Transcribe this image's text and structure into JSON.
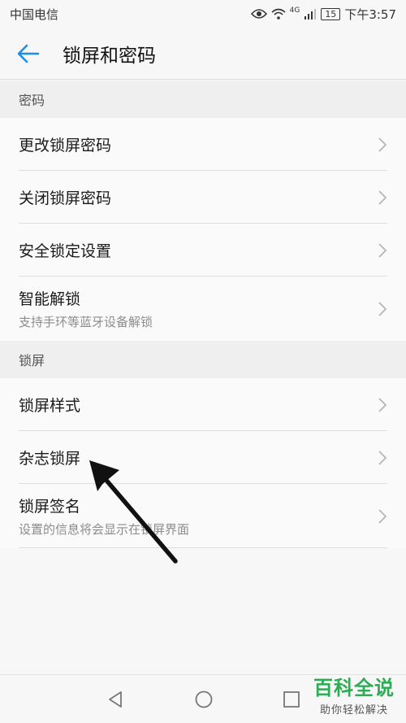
{
  "status_bar": {
    "carrier": "中国电信",
    "network": "4G",
    "battery": "15",
    "time": "下午3:57"
  },
  "header": {
    "title": "锁屏和密码",
    "back_icon": "arrow-left-icon",
    "accent_color": "#1d8ee5"
  },
  "sections": [
    {
      "title": "密码",
      "items": [
        {
          "title": "更改锁屏密码"
        },
        {
          "title": "关闭锁屏密码"
        },
        {
          "title": "安全锁定设置"
        },
        {
          "title": "智能解锁",
          "subtitle": "支持手环等蓝牙设备解锁"
        }
      ]
    },
    {
      "title": "锁屏",
      "items": [
        {
          "title": "锁屏样式"
        },
        {
          "title": "杂志锁屏"
        },
        {
          "title": "锁屏签名",
          "subtitle": "设置的信息将会显示在锁屏界面"
        }
      ]
    }
  ],
  "nav_bar": {
    "back_icon": "triangle-back-icon",
    "home_icon": "circle-home-icon",
    "recent_icon": "square-recent-icon"
  },
  "watermark": {
    "main": "百科全说",
    "sub": "助你轻松解决",
    "color": "#2eac55"
  }
}
